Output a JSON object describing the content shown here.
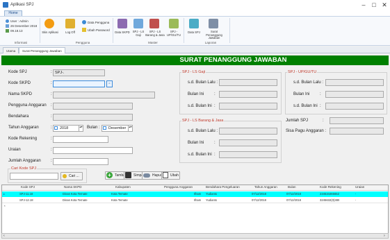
{
  "window": {
    "title": "Aplikasi SPJ",
    "minimize": "–",
    "maximize": "□",
    "close": "✕"
  },
  "ribbon": {
    "tab_home": "Home",
    "info": {
      "user": "User : Admin",
      "date": "26 Desember 2018",
      "time": "09.18.13",
      "group": "Informasi"
    },
    "pengguna": {
      "skin": "Skin Aplikasi",
      "logoff": "Log Off",
      "data_pengguna": "Data Pengguna",
      "ubah_password": "Ubah Password",
      "group": "Pengguna"
    },
    "master": {
      "data_skpd": "Data SKPD",
      "spj_ls_gaji": "SPJ - LS Gaji",
      "spj_ls_barang": "SPJ - LS Barang & Jasa",
      "spj_up": "SPJ - UP/GU/TU",
      "group": "Master"
    },
    "laporan": {
      "data_spj": "Data SPJ",
      "surat": "Surat Penanggung Jawaban",
      "group": "Laporan"
    }
  },
  "doc_tabs": [
    "Utama",
    "Surat Penanggung Jawaban"
  ],
  "header": "SURAT PENANGGUNG JAWABAN",
  "form": {
    "kode_spj": {
      "label": "Kode SPJ",
      "value": "SPJ-."
    },
    "kode_skpd": {
      "label": "Kode SKPD",
      "value": ""
    },
    "nama_skpd": {
      "label": "Nama SKPD",
      "value": ""
    },
    "pengguna_anggaran": {
      "label": "Pengguna Anggaran",
      "value": ""
    },
    "bendahara": {
      "label": "Bendahara",
      "value": ""
    },
    "tahun_anggaran": {
      "label": "Tahun Anggaran",
      "value": "2018",
      "bulan_label": "Bulan :",
      "bulan_value": "Desember"
    },
    "kode_rekening": {
      "label": "Kode Rekening",
      "value": ""
    },
    "uraian": {
      "label": "Uraian",
      "value": ""
    },
    "jumlah_anggaran": {
      "label": "Jumlah Anggaran",
      "value": ""
    }
  },
  "cari": {
    "legend": "Cari Kode SPJ",
    "value": "",
    "button": "Cari ..."
  },
  "actions": {
    "tambah": "Tambah",
    "simpan": "Simpan",
    "hapus": "Hapus",
    "ubah": "Ubah"
  },
  "gaji": {
    "legend": "SPJ - LS Gaji",
    "lalu": "s.d. Bulan Lalu :",
    "ini": "Bulan Ini",
    "sd_ini": "s.d. Bulan Ini"
  },
  "barang": {
    "legend": "SPJ - LS Barang & Jasa",
    "lalu": "s.d. Bulan Lalu :",
    "ini": "Bulan Ini",
    "sd_ini": "s.d. Bulan Ini"
  },
  "up": {
    "legend": "SPJ - UP/GU/TU",
    "lalu": "s.d. Bulan Lalu :",
    "ini": "Bulan Ini",
    "sd_ini": "s.d. Bulan Ini"
  },
  "summary": {
    "jumlah_spj": "Jumlah SPJ",
    "sisa_pagu": "Sisa Pagu Anggaran :"
  },
  "grid": {
    "columns": [
      "Kode SPJ",
      "Nama SKPD",
      "Kabupaten",
      "Pengguna Anggaran",
      "Bendahara Pengeluaran",
      "Tahun Anggaran",
      "Bulan",
      "Kode Rekening",
      "Uraian"
    ],
    "rows": [
      [
        "SPJ-11.18",
        "Dinas Kota Ternate",
        "Kota Ternate",
        "Ilham",
        "Yudianto",
        "07/12/2018",
        "07/12/2018",
        "234534465652",
        "-"
      ],
      [
        "SPJ-12.18",
        "Dinas Kota Ternate",
        "Kota Ternate",
        "Ilham",
        "Yudianto",
        "07/12/2018",
        "07/12/2018",
        "3245632(0)389",
        "-"
      ]
    ]
  },
  "colors": {
    "banner": "#008000",
    "selected_row": "#00ffff",
    "legend": "#c0392b"
  }
}
